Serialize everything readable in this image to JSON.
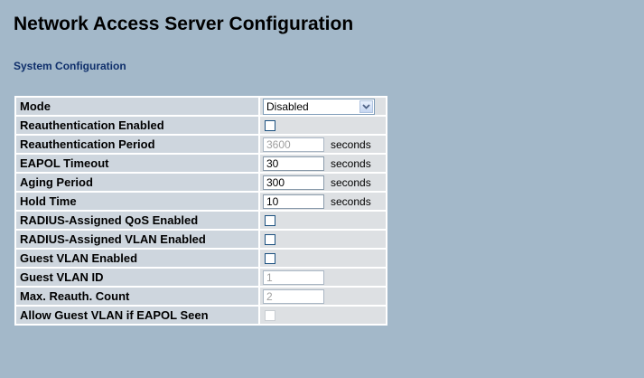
{
  "page": {
    "title": "Network Access Server Configuration",
    "section_title": "System Configuration"
  },
  "rows": {
    "mode": {
      "label": "Mode",
      "value": "Disabled"
    },
    "reauth_enabled": {
      "label": "Reauthentication Enabled",
      "checked": false
    },
    "reauth_period": {
      "label": "Reauthentication Period",
      "value": "3600",
      "unit": "seconds"
    },
    "eapol_timeout": {
      "label": "EAPOL Timeout",
      "value": "30",
      "unit": "seconds"
    },
    "aging_period": {
      "label": "Aging Period",
      "value": "300",
      "unit": "seconds"
    },
    "hold_time": {
      "label": "Hold Time",
      "value": "10",
      "unit": "seconds"
    },
    "radius_qos": {
      "label": "RADIUS-Assigned QoS Enabled",
      "checked": false
    },
    "radius_vlan": {
      "label": "RADIUS-Assigned VLAN Enabled",
      "checked": false
    },
    "guest_vlan_enabled": {
      "label": "Guest VLAN Enabled",
      "checked": false
    },
    "guest_vlan_id": {
      "label": "Guest VLAN ID",
      "value": "1"
    },
    "max_reauth_count": {
      "label": "Max. Reauth. Count",
      "value": "2"
    },
    "allow_guest_vlan": {
      "label": "Allow Guest VLAN if EAPOL Seen",
      "checked": false
    }
  },
  "icons": {
    "dropdown": "chevron-down-icon"
  },
  "colors": {
    "background": "#a3b8c9",
    "label_cell": "#ced6de",
    "value_cell": "#dde0e3",
    "section_title": "#0f2f6b"
  }
}
